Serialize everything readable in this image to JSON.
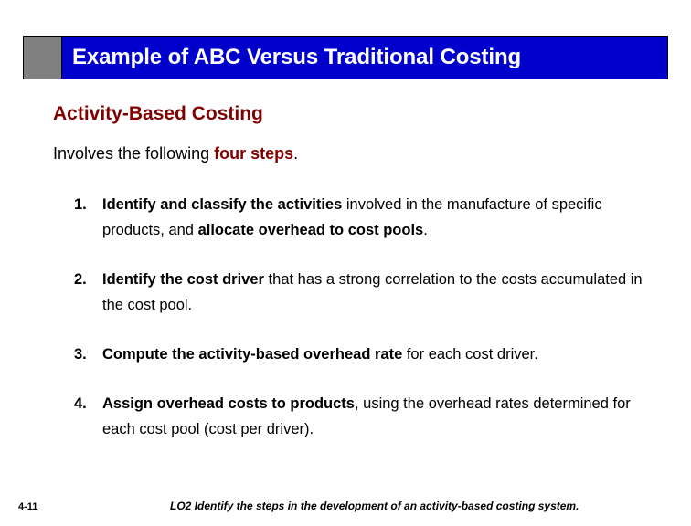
{
  "slide": {
    "title": "Example of ABC Versus Traditional Costing",
    "section_heading": "Activity-Based Costing",
    "lead": {
      "prefix": "Involves the following ",
      "highlight": "four steps",
      "suffix": "."
    },
    "steps": [
      {
        "number": "1.",
        "parts": [
          {
            "text": "Identify and classify the activities",
            "bold": true
          },
          {
            "text": " involved in the manufacture of specific products, and ",
            "bold": false
          },
          {
            "text": "allocate overhead to cost pools",
            "bold": true
          },
          {
            "text": ".",
            "bold": false
          }
        ]
      },
      {
        "number": "2.",
        "parts": [
          {
            "text": "Identify the cost driver",
            "bold": true
          },
          {
            "text": " that has a strong correlation to the costs accumulated in the cost pool.",
            "bold": false
          }
        ]
      },
      {
        "number": "3.",
        "parts": [
          {
            "text": "Compute the activity-based overhead rate",
            "bold": true
          },
          {
            "text": " for each cost driver.",
            "bold": false
          }
        ]
      },
      {
        "number": "4.",
        "parts": [
          {
            "text": "Assign overhead costs to products",
            "bold": true
          },
          {
            "text": ", using the overhead rates determined for each cost pool (cost per driver).",
            "bold": false
          }
        ]
      }
    ],
    "footer": {
      "page_number": "4-11",
      "learning_objective": "LO2  Identify the steps in the development of an activity-based costing system."
    },
    "colors": {
      "title_bar": "#0000cc",
      "title_swatch": "#808080",
      "title_text": "#ffffff",
      "accent_maroon": "#800000",
      "body_text": "#000000",
      "background": "#ffffff"
    }
  }
}
